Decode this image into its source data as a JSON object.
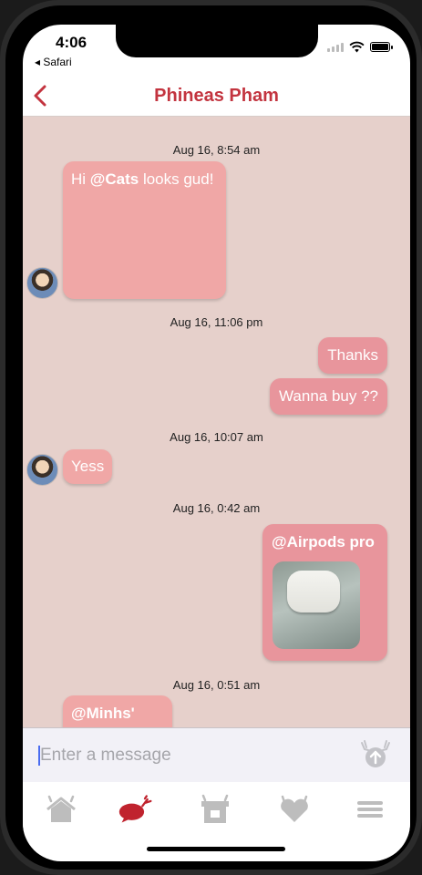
{
  "status": {
    "time": "4:06",
    "back_app": "◂ Safari"
  },
  "nav": {
    "title": "Phineas Pham"
  },
  "messages": [
    {
      "timestamp": "Aug 16, 8:54 am",
      "hi": "Hi ",
      "mention": "@Cats",
      "rest": " looks gud!"
    },
    {
      "timestamp": "Aug 16, 11:06 pm",
      "text1": "Thanks",
      "text2": "Wanna buy ??"
    },
    {
      "timestamp": "Aug 16, 10:07 am",
      "text": "Yess"
    },
    {
      "timestamp": "Aug 16, 0:42 am",
      "mention": "@Airpods pro"
    },
    {
      "timestamp": "Aug 16, 0:51 am",
      "mention": "@Minhs'"
    }
  ],
  "composer": {
    "placeholder": "Enter a message"
  },
  "tabs": {
    "items": [
      "home-icon",
      "chat-icon",
      "shop-icon",
      "heart-icon",
      "menu-icon"
    ],
    "active": "chat-icon"
  },
  "colors": {
    "accent": "#c3343f",
    "chat_bg": "#e6d0cb",
    "bubble_in": "#f0a7a6",
    "bubble_out": "#e8959c"
  }
}
